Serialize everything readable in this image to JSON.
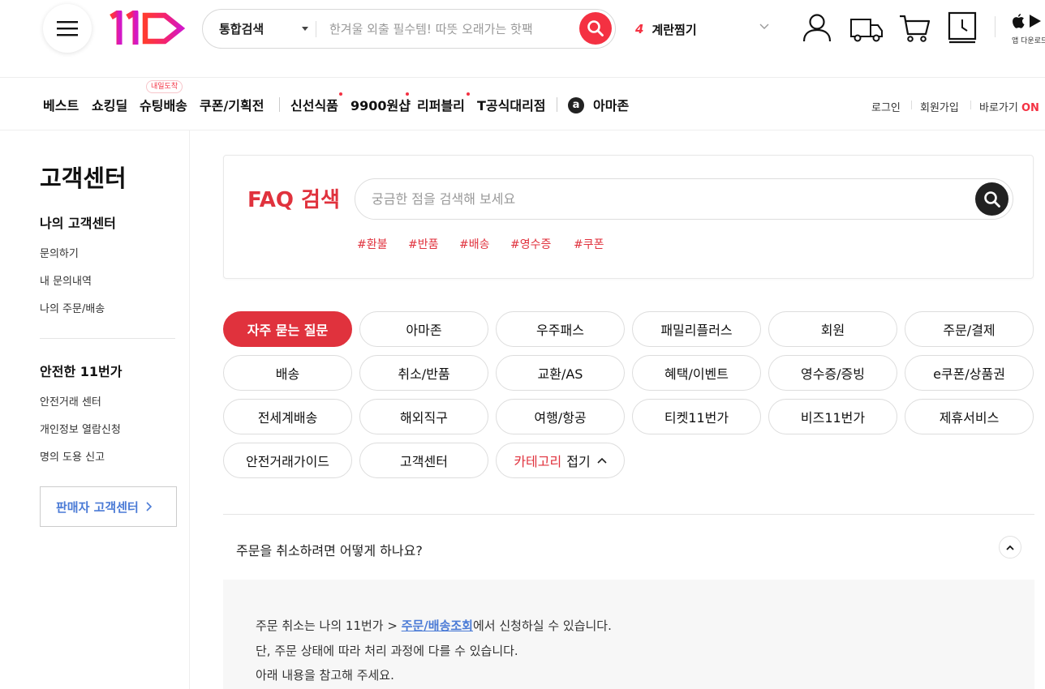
{
  "header": {
    "logo_alt": "11",
    "search": {
      "scope": "통합검색",
      "placeholder": "한겨울 외출 필수템! 따뜻 오래가는 핫팩"
    },
    "rank": {
      "number": "4",
      "keyword": "계란찜기"
    },
    "app_download_label": "앱 다운로드"
  },
  "gnb": {
    "items": [
      "베스트",
      "쇼킹딜",
      "슈팅배송",
      "쿠폰/기획전",
      "신선식품",
      "9900원샵",
      "리퍼블리",
      "T공식대리점",
      "아마존"
    ],
    "badge": "내일도착",
    "amazon_glyph": "a",
    "util": {
      "login": "로그인",
      "join": "회원가입",
      "shortcut": "바로가기",
      "on": "ON"
    }
  },
  "sidebar": {
    "title": "고객센터",
    "section1": {
      "title": "나의 고객센터",
      "links": [
        "문의하기",
        "내 문의내역",
        "나의 주문/배송"
      ]
    },
    "section2": {
      "title": "안전한 11번가",
      "links": [
        "안전거래 센터",
        "개인정보 열람신청",
        "명의 도용 신고"
      ]
    },
    "seller_button": "판매자 고객센터"
  },
  "faq": {
    "title": "FAQ 검색",
    "placeholder": "궁금한 점을 검색해 보세요",
    "hashtags": [
      "#환불",
      "#반품",
      "#배송",
      "#영수증",
      "#쿠폰"
    ]
  },
  "categories": {
    "items": [
      "자주 묻는 질문",
      "아마존",
      "우주패스",
      "패밀리플러스",
      "회원",
      "주문/결제",
      "배송",
      "취소/반품",
      "교환/AS",
      "혜택/이벤트",
      "영수증/증빙",
      "e쿠폰/상품권",
      "전세계배송",
      "해외직구",
      "여행/항공",
      "티켓11번가",
      "비즈11번가",
      "제휴서비스",
      "안전거래가이드",
      "고객센터"
    ],
    "active_index": 0,
    "collapse": {
      "category": "카테고리",
      "action": "접기"
    }
  },
  "accordion": {
    "question": "주문을 취소하려면 어떻게 하나요?",
    "answer": {
      "line1_prefix": "주문 취소는 나의 11번가 > ",
      "line1_link": "주문/배송조회",
      "line1_suffix": "에서 신청하실 수 있습니다.",
      "line2": "단, 주문 상태에 따라 처리 과정에 다를 수 있습니다.",
      "line3": "아래 내용을 참고해 주세요."
    }
  },
  "colors": {
    "brand_red": "#e0323d",
    "search_red": "#f43142",
    "link_blue": "#4b7bd6"
  },
  "icons": [
    "hamburger-icon",
    "search-icon",
    "chevron-down-icon",
    "user-icon",
    "truck-icon",
    "cart-icon",
    "recent-icon",
    "apple-icon",
    "play-store-icon",
    "chevron-right-icon",
    "chevron-up-icon"
  ]
}
